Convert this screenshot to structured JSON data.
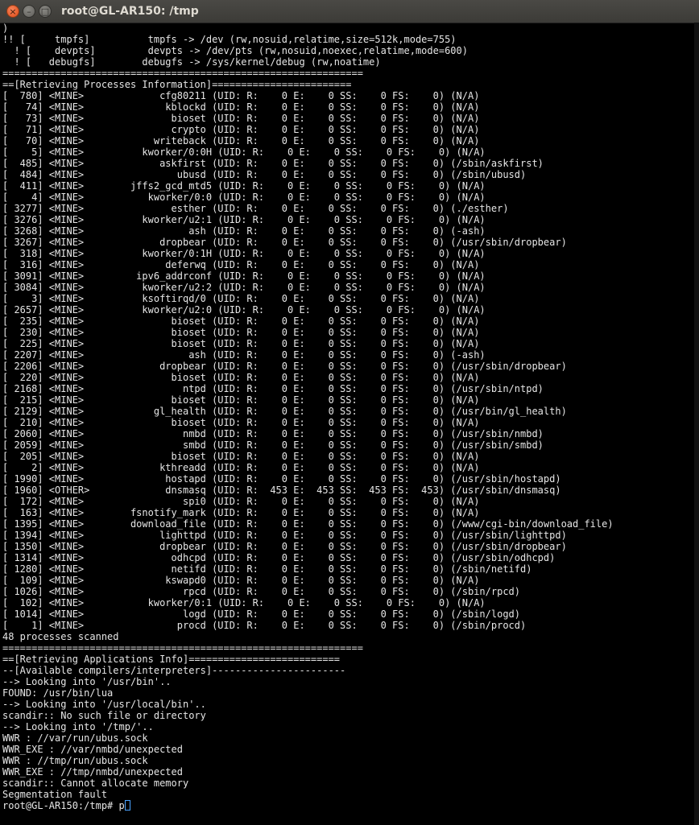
{
  "window": {
    "title": "root@GL-AR150: /tmp",
    "close_glyph": "×",
    "minimize_glyph": "–",
    "maximize_glyph": "□"
  },
  "terminal": {
    "lines": [
      ")",
      "!! [     tmpfs]          tmpfs -> /dev (rw,nosuid,relatime,size=512k,mode=755)",
      "  ! [    devpts]         devpts -> /dev/pts (rw,nosuid,noexec,relatime,mode=600)",
      "  ! [   debugfs]        debugfs -> /sys/kernel/debug (rw,noatime)",
      "==============================================================",
      "==[Retrieving Processes Information]========================",
      "[  780] <MINE>             cfg80211 (UID: R:    0 E:    0 SS:    0 FS:    0) (N/A)",
      "[   74] <MINE>              kblockd (UID: R:    0 E:    0 SS:    0 FS:    0) (N/A)",
      "[   73] <MINE>               bioset (UID: R:    0 E:    0 SS:    0 FS:    0) (N/A)",
      "[   71] <MINE>               crypto (UID: R:    0 E:    0 SS:    0 FS:    0) (N/A)",
      "[   70] <MINE>            writeback (UID: R:    0 E:    0 SS:    0 FS:    0) (N/A)",
      "[    5] <MINE>          kworker/0:0H (UID: R:    0 E:    0 SS:    0 FS:    0) (N/A)",
      "[  485] <MINE>             askfirst (UID: R:    0 E:    0 SS:    0 FS:    0) (/sbin/askfirst)",
      "[  484] <MINE>                ubusd (UID: R:    0 E:    0 SS:    0 FS:    0) (/sbin/ubusd)",
      "[  411] <MINE>        jffs2_gcd_mtd5 (UID: R:    0 E:    0 SS:    0 FS:    0) (N/A)",
      "[    4] <MINE>           kworker/0:0 (UID: R:    0 E:    0 SS:    0 FS:    0) (N/A)",
      "[ 3277] <MINE>               esther (UID: R:    0 E:    0 SS:    0 FS:    0) (./esther)",
      "[ 3276] <MINE>          kworker/u2:1 (UID: R:    0 E:    0 SS:    0 FS:    0) (N/A)",
      "[ 3268] <MINE>                  ash (UID: R:    0 E:    0 SS:    0 FS:    0) (-ash)",
      "[ 3267] <MINE>             dropbear (UID: R:    0 E:    0 SS:    0 FS:    0) (/usr/sbin/dropbear)",
      "[  318] <MINE>          kworker/0:1H (UID: R:    0 E:    0 SS:    0 FS:    0) (N/A)",
      "[  316] <MINE>              deferwq (UID: R:    0 E:    0 SS:    0 FS:    0) (N/A)",
      "[ 3091] <MINE>         ipv6_addrconf (UID: R:    0 E:    0 SS:    0 FS:    0) (N/A)",
      "[ 3084] <MINE>          kworker/u2:2 (UID: R:    0 E:    0 SS:    0 FS:    0) (N/A)",
      "[    3] <MINE>          ksoftirqd/0 (UID: R:    0 E:    0 SS:    0 FS:    0) (N/A)",
      "[ 2657] <MINE>          kworker/u2:0 (UID: R:    0 E:    0 SS:    0 FS:    0) (N/A)",
      "[  235] <MINE>               bioset (UID: R:    0 E:    0 SS:    0 FS:    0) (N/A)",
      "[  230] <MINE>               bioset (UID: R:    0 E:    0 SS:    0 FS:    0) (N/A)",
      "[  225] <MINE>               bioset (UID: R:    0 E:    0 SS:    0 FS:    0) (N/A)",
      "[ 2207] <MINE>                  ash (UID: R:    0 E:    0 SS:    0 FS:    0) (-ash)",
      "[ 2206] <MINE>             dropbear (UID: R:    0 E:    0 SS:    0 FS:    0) (/usr/sbin/dropbear)",
      "[  220] <MINE>               bioset (UID: R:    0 E:    0 SS:    0 FS:    0) (N/A)",
      "[ 2168] <MINE>                 ntpd (UID: R:    0 E:    0 SS:    0 FS:    0) (/usr/sbin/ntpd)",
      "[  215] <MINE>               bioset (UID: R:    0 E:    0 SS:    0 FS:    0) (N/A)",
      "[ 2129] <MINE>            gl_health (UID: R:    0 E:    0 SS:    0 FS:    0) (/usr/bin/gl_health)",
      "[  210] <MINE>               bioset (UID: R:    0 E:    0 SS:    0 FS:    0) (N/A)",
      "[ 2060] <MINE>                 nmbd (UID: R:    0 E:    0 SS:    0 FS:    0) (/usr/sbin/nmbd)",
      "[ 2059] <MINE>                 smbd (UID: R:    0 E:    0 SS:    0 FS:    0) (/usr/sbin/smbd)",
      "[  205] <MINE>               bioset (UID: R:    0 E:    0 SS:    0 FS:    0) (N/A)",
      "[    2] <MINE>             kthreadd (UID: R:    0 E:    0 SS:    0 FS:    0) (N/A)",
      "[ 1990] <MINE>              hostapd (UID: R:    0 E:    0 SS:    0 FS:    0) (/usr/sbin/hostapd)",
      "[ 1960] <OTHER>             dnsmasq (UID: R:  453 E:  453 SS:  453 FS:  453) (/usr/sbin/dnsmasq)",
      "[  172] <MINE>                 spi0 (UID: R:    0 E:    0 SS:    0 FS:    0) (N/A)",
      "[  163] <MINE>        fsnotify_mark (UID: R:    0 E:    0 SS:    0 FS:    0) (N/A)",
      "[ 1395] <MINE>        download_file (UID: R:    0 E:    0 SS:    0 FS:    0) (/www/cgi-bin/download_file)",
      "[ 1394] <MINE>             lighttpd (UID: R:    0 E:    0 SS:    0 FS:    0) (/usr/sbin/lighttpd)",
      "[ 1350] <MINE>             dropbear (UID: R:    0 E:    0 SS:    0 FS:    0) (/usr/sbin/dropbear)",
      "[ 1314] <MINE>               odhcpd (UID: R:    0 E:    0 SS:    0 FS:    0) (/usr/sbin/odhcpd)",
      "[ 1280] <MINE>               netifd (UID: R:    0 E:    0 SS:    0 FS:    0) (/sbin/netifd)",
      "[  109] <MINE>              kswapd0 (UID: R:    0 E:    0 SS:    0 FS:    0) (N/A)",
      "[ 1026] <MINE>                 rpcd (UID: R:    0 E:    0 SS:    0 FS:    0) (/sbin/rpcd)",
      "[  102] <MINE>           kworker/0:1 (UID: R:    0 E:    0 SS:    0 FS:    0) (N/A)",
      "[ 1014] <MINE>                 logd (UID: R:    0 E:    0 SS:    0 FS:    0) (/sbin/logd)",
      "[    1] <MINE>                procd (UID: R:    0 E:    0 SS:    0 FS:    0) (/sbin/procd)",
      "48 processes scanned",
      "==============================================================",
      "==[Retrieving Applications Info]==========================",
      "--[Available compilers/interpreters]-----------------------",
      "--> Looking into '/usr/bin'..",
      "FOUND: /usr/bin/lua",
      "--> Looking into '/usr/local/bin'..",
      "scandir:: No such file or directory",
      "--> Looking into '/tmp/'..",
      "WWR : //var/run/ubus.sock",
      "WWR_EXE : //var/nmbd/unexpected",
      "WWR : //tmp/run/ubus.sock",
      "WWR_EXE : //tmp/nmbd/unexpected",
      "scandir:: Cannot allocate memory",
      "Segmentation fault"
    ],
    "prompt": "root@GL-AR150:/tmp# ",
    "input_value": "p"
  }
}
